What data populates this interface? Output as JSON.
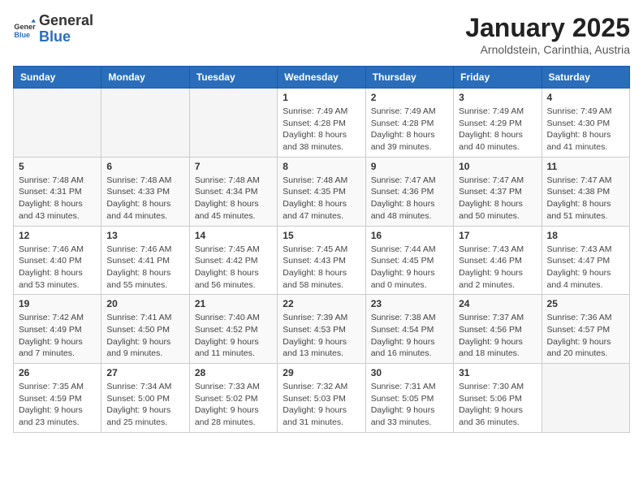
{
  "header": {
    "logo": {
      "general": "General",
      "blue": "Blue"
    },
    "title": "January 2025",
    "location": "Arnoldstein, Carinthia, Austria"
  },
  "calendar": {
    "weekdays": [
      "Sunday",
      "Monday",
      "Tuesday",
      "Wednesday",
      "Thursday",
      "Friday",
      "Saturday"
    ],
    "weeks": [
      [
        {
          "day": "",
          "empty": true
        },
        {
          "day": "",
          "empty": true
        },
        {
          "day": "",
          "empty": true
        },
        {
          "day": "1",
          "sunrise": "7:49 AM",
          "sunset": "4:28 PM",
          "daylight": "8 hours and 38 minutes."
        },
        {
          "day": "2",
          "sunrise": "7:49 AM",
          "sunset": "4:28 PM",
          "daylight": "8 hours and 39 minutes."
        },
        {
          "day": "3",
          "sunrise": "7:49 AM",
          "sunset": "4:29 PM",
          "daylight": "8 hours and 40 minutes."
        },
        {
          "day": "4",
          "sunrise": "7:49 AM",
          "sunset": "4:30 PM",
          "daylight": "8 hours and 41 minutes."
        }
      ],
      [
        {
          "day": "5",
          "sunrise": "7:48 AM",
          "sunset": "4:31 PM",
          "daylight": "8 hours and 43 minutes."
        },
        {
          "day": "6",
          "sunrise": "7:48 AM",
          "sunset": "4:33 PM",
          "daylight": "8 hours and 44 minutes."
        },
        {
          "day": "7",
          "sunrise": "7:48 AM",
          "sunset": "4:34 PM",
          "daylight": "8 hours and 45 minutes."
        },
        {
          "day": "8",
          "sunrise": "7:48 AM",
          "sunset": "4:35 PM",
          "daylight": "8 hours and 47 minutes."
        },
        {
          "day": "9",
          "sunrise": "7:47 AM",
          "sunset": "4:36 PM",
          "daylight": "8 hours and 48 minutes."
        },
        {
          "day": "10",
          "sunrise": "7:47 AM",
          "sunset": "4:37 PM",
          "daylight": "8 hours and 50 minutes."
        },
        {
          "day": "11",
          "sunrise": "7:47 AM",
          "sunset": "4:38 PM",
          "daylight": "8 hours and 51 minutes."
        }
      ],
      [
        {
          "day": "12",
          "sunrise": "7:46 AM",
          "sunset": "4:40 PM",
          "daylight": "8 hours and 53 minutes."
        },
        {
          "day": "13",
          "sunrise": "7:46 AM",
          "sunset": "4:41 PM",
          "daylight": "8 hours and 55 minutes."
        },
        {
          "day": "14",
          "sunrise": "7:45 AM",
          "sunset": "4:42 PM",
          "daylight": "8 hours and 56 minutes."
        },
        {
          "day": "15",
          "sunrise": "7:45 AM",
          "sunset": "4:43 PM",
          "daylight": "8 hours and 58 minutes."
        },
        {
          "day": "16",
          "sunrise": "7:44 AM",
          "sunset": "4:45 PM",
          "daylight": "9 hours and 0 minutes."
        },
        {
          "day": "17",
          "sunrise": "7:43 AM",
          "sunset": "4:46 PM",
          "daylight": "9 hours and 2 minutes."
        },
        {
          "day": "18",
          "sunrise": "7:43 AM",
          "sunset": "4:47 PM",
          "daylight": "9 hours and 4 minutes."
        }
      ],
      [
        {
          "day": "19",
          "sunrise": "7:42 AM",
          "sunset": "4:49 PM",
          "daylight": "9 hours and 7 minutes."
        },
        {
          "day": "20",
          "sunrise": "7:41 AM",
          "sunset": "4:50 PM",
          "daylight": "9 hours and 9 minutes."
        },
        {
          "day": "21",
          "sunrise": "7:40 AM",
          "sunset": "4:52 PM",
          "daylight": "9 hours and 11 minutes."
        },
        {
          "day": "22",
          "sunrise": "7:39 AM",
          "sunset": "4:53 PM",
          "daylight": "9 hours and 13 minutes."
        },
        {
          "day": "23",
          "sunrise": "7:38 AM",
          "sunset": "4:54 PM",
          "daylight": "9 hours and 16 minutes."
        },
        {
          "day": "24",
          "sunrise": "7:37 AM",
          "sunset": "4:56 PM",
          "daylight": "9 hours and 18 minutes."
        },
        {
          "day": "25",
          "sunrise": "7:36 AM",
          "sunset": "4:57 PM",
          "daylight": "9 hours and 20 minutes."
        }
      ],
      [
        {
          "day": "26",
          "sunrise": "7:35 AM",
          "sunset": "4:59 PM",
          "daylight": "9 hours and 23 minutes."
        },
        {
          "day": "27",
          "sunrise": "7:34 AM",
          "sunset": "5:00 PM",
          "daylight": "9 hours and 25 minutes."
        },
        {
          "day": "28",
          "sunrise": "7:33 AM",
          "sunset": "5:02 PM",
          "daylight": "9 hours and 28 minutes."
        },
        {
          "day": "29",
          "sunrise": "7:32 AM",
          "sunset": "5:03 PM",
          "daylight": "9 hours and 31 minutes."
        },
        {
          "day": "30",
          "sunrise": "7:31 AM",
          "sunset": "5:05 PM",
          "daylight": "9 hours and 33 minutes."
        },
        {
          "day": "31",
          "sunrise": "7:30 AM",
          "sunset": "5:06 PM",
          "daylight": "9 hours and 36 minutes."
        },
        {
          "day": "",
          "empty": true
        }
      ]
    ]
  }
}
